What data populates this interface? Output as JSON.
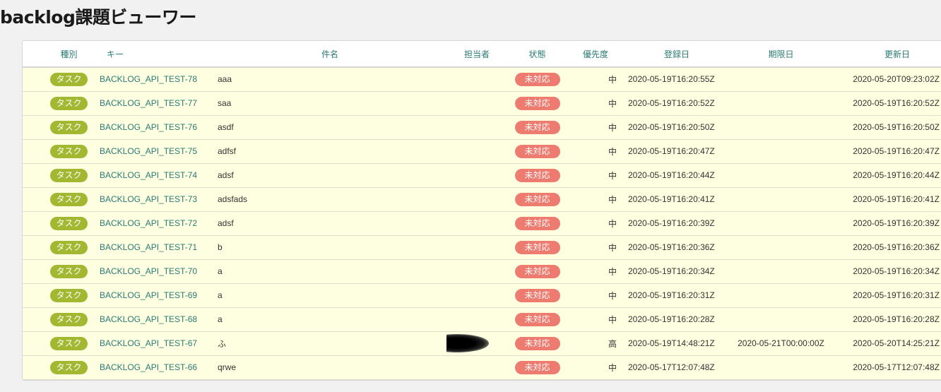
{
  "page": {
    "title": "backlog課題ビューワー"
  },
  "colors": {
    "accent": "#2a7b74",
    "type_badge": "#a1b830",
    "status_open": "#ee7b6f",
    "row_background": "#fefee0"
  },
  "table": {
    "headers": {
      "type": "種別",
      "key": "キー",
      "summary": "件名",
      "assignee": "担当者",
      "status": "状態",
      "priority": "優先度",
      "created": "登録日",
      "due": "期限日",
      "updated": "更新日"
    },
    "rows": [
      {
        "type": "タスク",
        "key": "BACKLOG_API_TEST-78",
        "summary": "aaa",
        "assignee": "",
        "status": "未対応",
        "priority": "中",
        "created": "2020-05-19T16:20:55Z",
        "due": "",
        "updated": "2020-05-20T09:23:02Z"
      },
      {
        "type": "タスク",
        "key": "BACKLOG_API_TEST-77",
        "summary": "saa",
        "assignee": "",
        "status": "未対応",
        "priority": "中",
        "created": "2020-05-19T16:20:52Z",
        "due": "",
        "updated": "2020-05-19T16:20:52Z"
      },
      {
        "type": "タスク",
        "key": "BACKLOG_API_TEST-76",
        "summary": "asdf",
        "assignee": "",
        "status": "未対応",
        "priority": "中",
        "created": "2020-05-19T16:20:50Z",
        "due": "",
        "updated": "2020-05-19T16:20:50Z"
      },
      {
        "type": "タスク",
        "key": "BACKLOG_API_TEST-75",
        "summary": "adfsf",
        "assignee": "",
        "status": "未対応",
        "priority": "中",
        "created": "2020-05-19T16:20:47Z",
        "due": "",
        "updated": "2020-05-19T16:20:47Z"
      },
      {
        "type": "タスク",
        "key": "BACKLOG_API_TEST-74",
        "summary": "adsf",
        "assignee": "",
        "status": "未対応",
        "priority": "中",
        "created": "2020-05-19T16:20:44Z",
        "due": "",
        "updated": "2020-05-19T16:20:44Z"
      },
      {
        "type": "タスク",
        "key": "BACKLOG_API_TEST-73",
        "summary": "adsfads",
        "assignee": "",
        "status": "未対応",
        "priority": "中",
        "created": "2020-05-19T16:20:41Z",
        "due": "",
        "updated": "2020-05-19T16:20:41Z"
      },
      {
        "type": "タスク",
        "key": "BACKLOG_API_TEST-72",
        "summary": "adsf",
        "assignee": "",
        "status": "未対応",
        "priority": "中",
        "created": "2020-05-19T16:20:39Z",
        "due": "",
        "updated": "2020-05-19T16:20:39Z"
      },
      {
        "type": "タスク",
        "key": "BACKLOG_API_TEST-71",
        "summary": "b",
        "assignee": "",
        "status": "未対応",
        "priority": "中",
        "created": "2020-05-19T16:20:36Z",
        "due": "",
        "updated": "2020-05-19T16:20:36Z"
      },
      {
        "type": "タスク",
        "key": "BACKLOG_API_TEST-70",
        "summary": "a",
        "assignee": "",
        "status": "未対応",
        "priority": "中",
        "created": "2020-05-19T16:20:34Z",
        "due": "",
        "updated": "2020-05-19T16:20:34Z"
      },
      {
        "type": "タスク",
        "key": "BACKLOG_API_TEST-69",
        "summary": "a",
        "assignee": "",
        "status": "未対応",
        "priority": "中",
        "created": "2020-05-19T16:20:31Z",
        "due": "",
        "updated": "2020-05-19T16:20:31Z"
      },
      {
        "type": "タスク",
        "key": "BACKLOG_API_TEST-68",
        "summary": "a",
        "assignee": "",
        "status": "未対応",
        "priority": "中",
        "created": "2020-05-19T16:20:28Z",
        "due": "",
        "updated": "2020-05-19T16:20:28Z"
      },
      {
        "type": "タスク",
        "key": "BACKLOG_API_TEST-67",
        "summary": "ふ",
        "assignee": "",
        "assignee_redacted": true,
        "status": "未対応",
        "priority": "高",
        "created": "2020-05-19T14:48:21Z",
        "due": "2020-05-21T00:00:00Z",
        "updated": "2020-05-20T14:25:21Z"
      },
      {
        "type": "タスク",
        "key": "BACKLOG_API_TEST-66",
        "summary": "qrwe",
        "assignee": "",
        "status": "未対応",
        "priority": "中",
        "created": "2020-05-17T12:07:48Z",
        "due": "",
        "updated": "2020-05-17T12:07:48Z"
      }
    ]
  }
}
